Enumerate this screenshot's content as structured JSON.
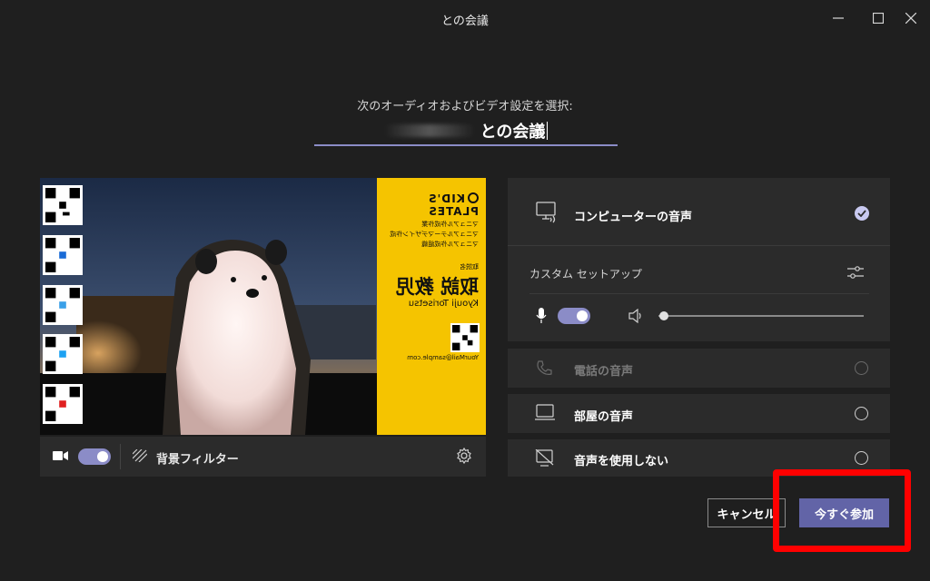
{
  "window": {
    "title": "との会議",
    "minimize_icon": "minimize-icon",
    "maximize_icon": "maximize-icon",
    "close_icon": "close-icon"
  },
  "setup": {
    "subtitle": "次のオーディオおよびビデオ設定を選択:",
    "meeting_name_value": "との会議"
  },
  "preview_card": {
    "brand": "KID'S PLATES",
    "line1": "マニュアル作成作業",
    "line2": "マニュアルテーマデザイン作成",
    "line3": "マニュアル作成組織",
    "role": "取説名",
    "name_jp": "取説 教児",
    "name_romaji": "Kyouji Torisetsu",
    "email": "YourMail@sample.com"
  },
  "video_controls": {
    "camera_on": true,
    "background_filter_label": "背景フィルター"
  },
  "audio": {
    "computer_audio_label": "コンピューターの音声",
    "computer_audio_selected": true,
    "custom_setup_label": "カスタム セットアップ",
    "mic_on": true,
    "speaker_volume": 0.0,
    "phone_audio_label": "電話の音声",
    "room_audio_label": "部屋の音声",
    "no_audio_label": "音声を使用しない"
  },
  "actions": {
    "cancel_label": "キャンセル",
    "join_label": "今すぐ参加"
  },
  "colors": {
    "accent": "#6264a7",
    "toggle": "#8b8cc7",
    "highlight": "#ff0000",
    "card_yellow": "#f5c400"
  }
}
